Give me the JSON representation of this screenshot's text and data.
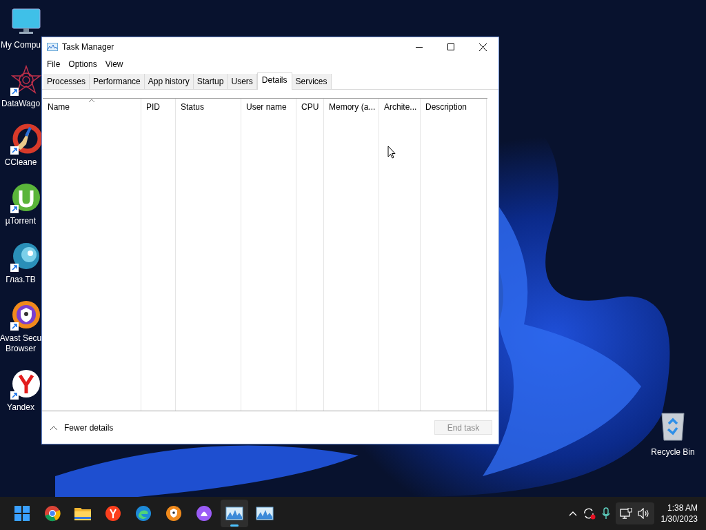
{
  "desktop_icons": [
    {
      "kind": "computer",
      "label_lines": [
        "My Compu"
      ],
      "shortcut": false
    },
    {
      "kind": "star",
      "label_lines": [
        "DataWago"
      ],
      "shortcut": true
    },
    {
      "kind": "cleaner",
      "label_lines": [
        "CCleane"
      ],
      "shortcut": true
    },
    {
      "kind": "torrent",
      "label_lines": [
        "µTorrent"
      ],
      "shortcut": true
    },
    {
      "kind": "eye",
      "label_lines": [
        "Глаз.ТВ"
      ],
      "shortcut": true
    },
    {
      "kind": "shield",
      "label_lines": [
        "Avast Secu",
        "Browser"
      ],
      "shortcut": true
    },
    {
      "kind": "yandex",
      "label_lines": [
        "Yandex"
      ],
      "shortcut": true
    }
  ],
  "recycle_bin": {
    "label": "Recycle Bin"
  },
  "window": {
    "title": "Task Manager"
  },
  "menu": [
    "File",
    "Options",
    "View"
  ],
  "tabs": [
    {
      "label": "Processes",
      "selected": false
    },
    {
      "label": "Performance",
      "selected": false
    },
    {
      "label": "App history",
      "selected": false
    },
    {
      "label": "Startup",
      "selected": false
    },
    {
      "label": "Users",
      "selected": false
    },
    {
      "label": "Details",
      "selected": true
    },
    {
      "label": "Services",
      "selected": false
    }
  ],
  "table": {
    "columns": [
      {
        "label": "Name",
        "sorted": true
      },
      {
        "label": "PID",
        "sorted": false
      },
      {
        "label": "Status",
        "sorted": false
      },
      {
        "label": "User name",
        "sorted": false
      },
      {
        "label": "CPU",
        "sorted": false
      },
      {
        "label": "Memory (a...",
        "sorted": false
      },
      {
        "label": "Archite...",
        "sorted": false
      },
      {
        "label": "Description",
        "sorted": false
      }
    ]
  },
  "footer": {
    "toggle": "Fewer details",
    "button": {
      "label": "End task",
      "disabled": true
    }
  },
  "taskbar": {
    "apps": [
      {
        "kind": "start",
        "active": false
      },
      {
        "kind": "chrome",
        "active": false
      },
      {
        "kind": "folder",
        "active": false
      },
      {
        "kind": "yandex",
        "active": false
      },
      {
        "kind": "edge",
        "active": false
      },
      {
        "kind": "shield",
        "active": false
      },
      {
        "kind": "alice",
        "active": false
      },
      {
        "kind": "monitor",
        "active": true
      },
      {
        "kind": "monitor",
        "active": false
      }
    ],
    "tray": {
      "time": "1:38 AM",
      "date": "1/30/2023"
    }
  }
}
